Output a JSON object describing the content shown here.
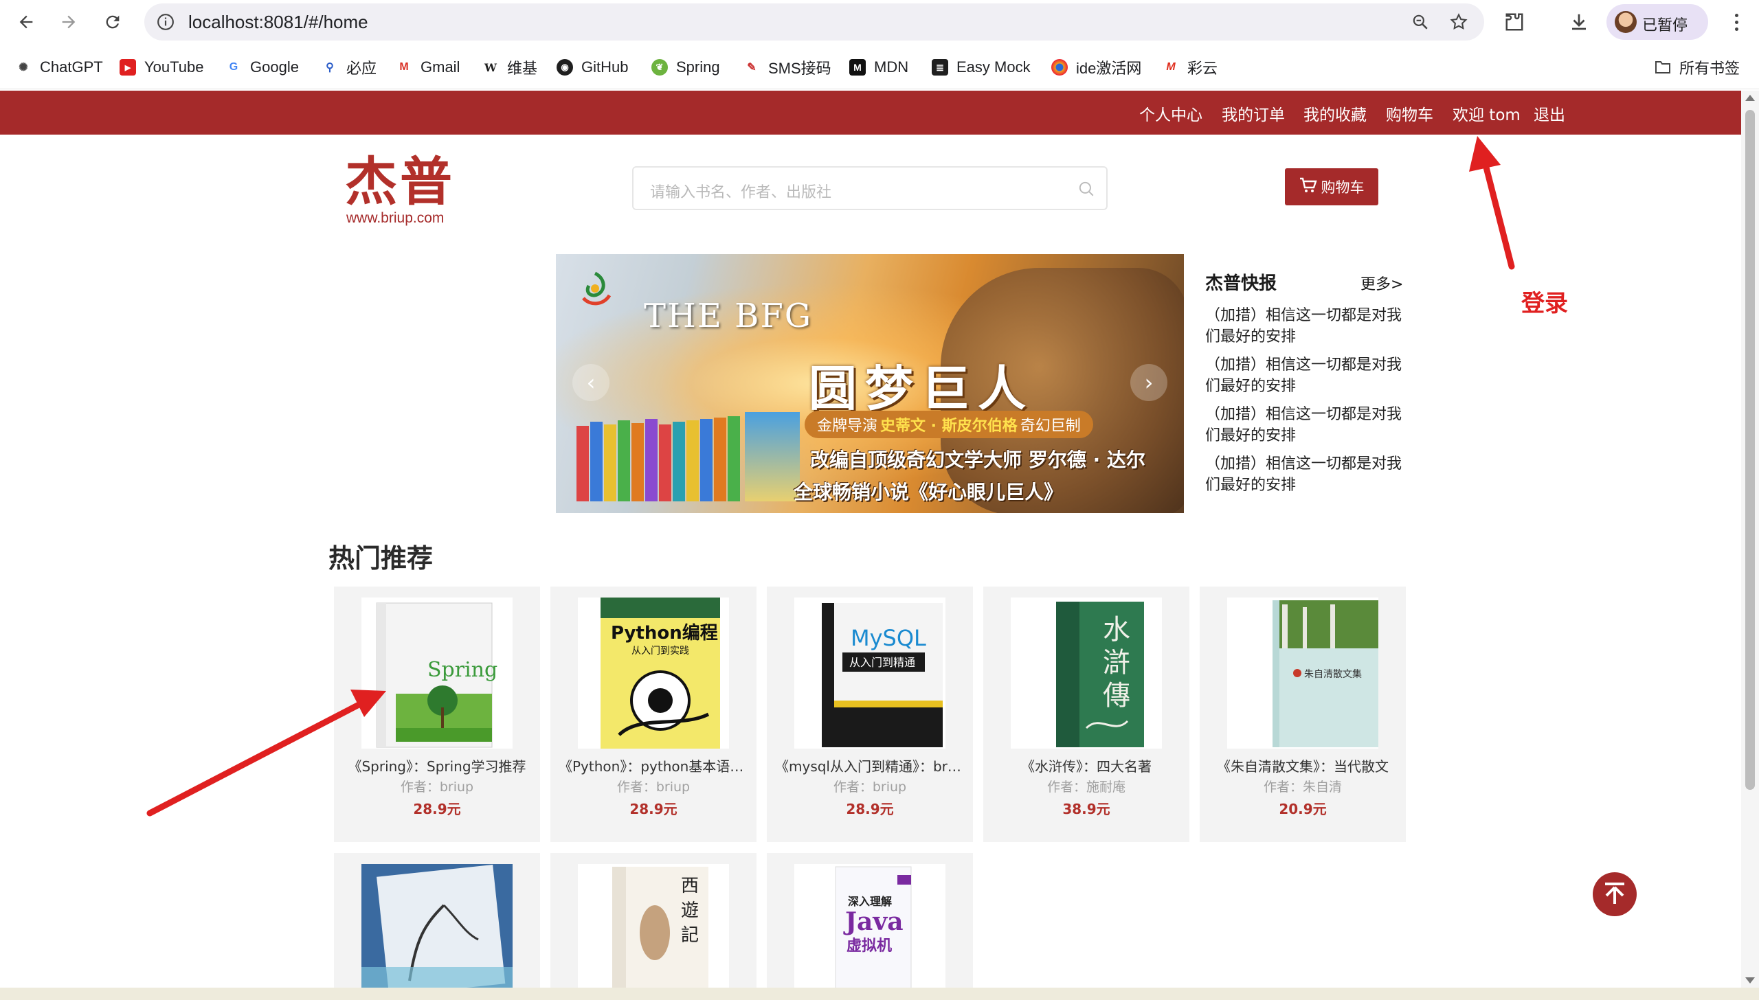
{
  "browser": {
    "url": "localhost:8081/#/home",
    "profile_status": "已暂停",
    "bookmarks": [
      "ChatGPT",
      "YouTube",
      "Google",
      "必应",
      "Gmail",
      "维基",
      "GitHub",
      "Spring",
      "SMS接码",
      "MDN",
      "Easy Mock",
      "ide激活网",
      "彩云"
    ],
    "all_bookmarks": "所有书签"
  },
  "topnav": {
    "links": [
      "个人中心",
      "我的订单",
      "我的收藏",
      "购物车",
      "欢迎 tom",
      "退出"
    ]
  },
  "header": {
    "logo_cn": "杰普",
    "logo_en": "www.briup.com",
    "search_placeholder": "请输入书名、作者、出版社",
    "cart_button": "购物车"
  },
  "banner": {
    "bfg": "THE BFG",
    "title": "圆梦巨人",
    "pill_pre": "金牌导演",
    "pill_name": "史蒂文 · 斯皮尔伯格",
    "pill_post": "奇幻巨制",
    "line1": "改编自顶级奇幻文学大师 罗尔德 · 达尔",
    "line2": "全球畅销小说《好心眼儿巨人》"
  },
  "news": {
    "title": "杰普快报",
    "more": "更多>",
    "items": [
      "（加措）相信这一切都是对我们最好的安排",
      "（加措）相信这一切都是对我们最好的安排",
      "（加措）相信这一切都是对我们最好的安排",
      "（加措）相信这一切都是对我们最好的安排"
    ]
  },
  "hot": {
    "title": "热门推荐",
    "books": [
      {
        "name": "《Spring》：Spring学习推荐",
        "author": "作者：briup",
        "price": "28.9元"
      },
      {
        "name": "《Python》：python基本语法学习",
        "author": "作者：briup",
        "price": "28.9元"
      },
      {
        "name": "《mysql从入门到精通》：briup",
        "author": "作者：briup",
        "price": "28.9元"
      },
      {
        "name": "《水浒传》：四大名著",
        "author": "作者：施耐庵",
        "price": "38.9元"
      },
      {
        "name": "《朱自清散文集》：当代散文",
        "author": "作者：朱自清",
        "price": "20.9元"
      }
    ]
  },
  "annotation": {
    "login_label": "登录"
  },
  "colors": {
    "brand": "#a52a2a",
    "price": "#b2302a",
    "annotation": "#e02020"
  }
}
